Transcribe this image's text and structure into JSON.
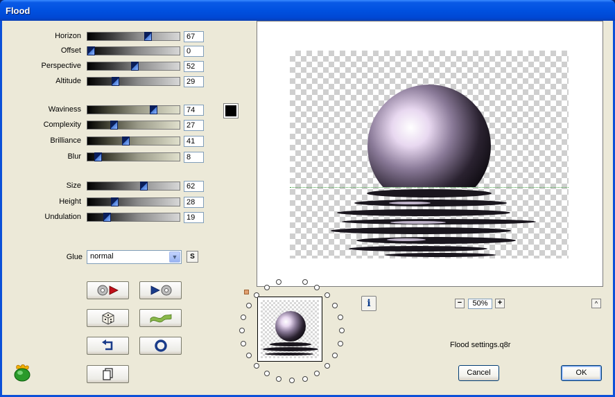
{
  "window": {
    "title": "Flood"
  },
  "sliders": [
    {
      "label": "Horizon",
      "value": "67",
      "level": 67
    },
    {
      "label": "Offset",
      "value": "0",
      "level": 0
    },
    {
      "label": "Perspective",
      "value": "52",
      "level": 52
    },
    {
      "label": "Altitude",
      "value": "29",
      "level": 29
    },
    {
      "label": "Waviness",
      "value": "74",
      "level": 74
    },
    {
      "label": "Complexity",
      "value": "27",
      "level": 27
    },
    {
      "label": "Brilliance",
      "value": "41",
      "level": 41
    },
    {
      "label": "Blur",
      "value": "8",
      "level": 8
    },
    {
      "label": "Size",
      "value": "62",
      "level": 62
    },
    {
      "label": "Height",
      "value": "28",
      "level": 28
    },
    {
      "label": "Undulation",
      "value": "19",
      "level": 19
    }
  ],
  "color_swatch": "#000000",
  "glue": {
    "label": "Glue",
    "value": "normal",
    "s_button": "S"
  },
  "toolbar_icons": [
    "load-preset-icon",
    "save-preset-icon",
    "randomize-dice-icon",
    "wave-icon",
    "undo-icon",
    "reset-icon",
    "copy-icon"
  ],
  "preview": {
    "zoom": "50%",
    "minus": "−",
    "plus": "+",
    "collapse": "^",
    "info": "i"
  },
  "settings_file": "Flood settings.q8r",
  "buttons": {
    "cancel": "Cancel",
    "ok": "OK"
  },
  "colors": {
    "titlebar": "#0051e0",
    "panel": "#ece9d8",
    "accent": "#0a1e5a"
  }
}
